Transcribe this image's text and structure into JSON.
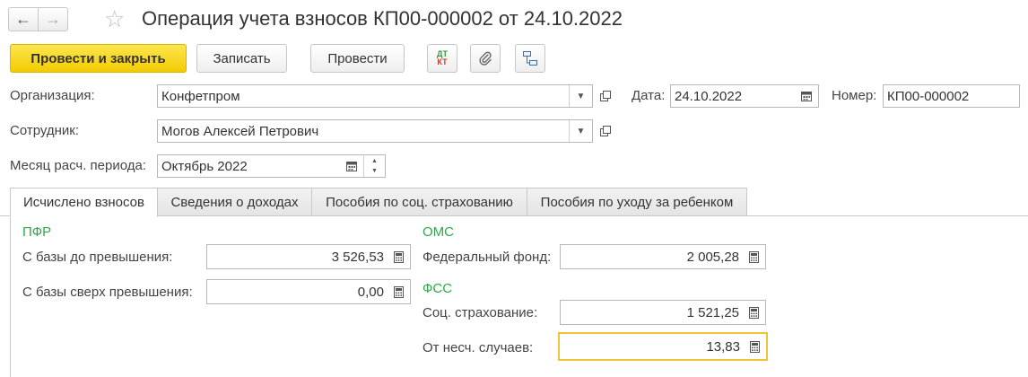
{
  "header": {
    "title": "Операция учета взносов КП00-000002 от 24.10.2022"
  },
  "toolbar": {
    "post_close_label": "Провести и закрыть",
    "save_label": "Записать",
    "post_label": "Провести",
    "dtkt_dt": "ДТ",
    "dtkt_kt": "КТ"
  },
  "form": {
    "organization_label": "Организация:",
    "organization_value": "Конфетпром",
    "date_label": "Дата:",
    "date_value": "24.10.2022",
    "number_label": "Номер:",
    "number_value": "КП00-000002",
    "employee_label": "Сотрудник:",
    "employee_value": "Могов Алексей Петрович",
    "period_label": "Месяц расч. периода:",
    "period_value": "Октябрь 2022"
  },
  "tabs": [
    {
      "label": "Исчислено взносов",
      "active": true
    },
    {
      "label": "Сведения о доходах",
      "active": false
    },
    {
      "label": "Пособия по соц. страхованию",
      "active": false
    },
    {
      "label": "Пособия по уходу за ребенком",
      "active": false
    }
  ],
  "pfr": {
    "heading": "ПФР",
    "base_below_label": "С базы до превышения:",
    "base_below_value": "3 526,53",
    "base_above_label": "С базы сверх превышения:",
    "base_above_value": "0,00"
  },
  "oms": {
    "heading": "ОМС",
    "federal_label": "Федеральный фонд:",
    "federal_value": "2 005,28"
  },
  "fss": {
    "heading": "ФСС",
    "social_label": "Соц. страхование:",
    "social_value": "1 521,25",
    "accident_label": "От несч. случаев:",
    "accident_value": "13,83"
  },
  "colors": {
    "primary_button": "#f7d21c",
    "section_heading": "#2ea64b",
    "focus_border": "#f1c33a"
  }
}
